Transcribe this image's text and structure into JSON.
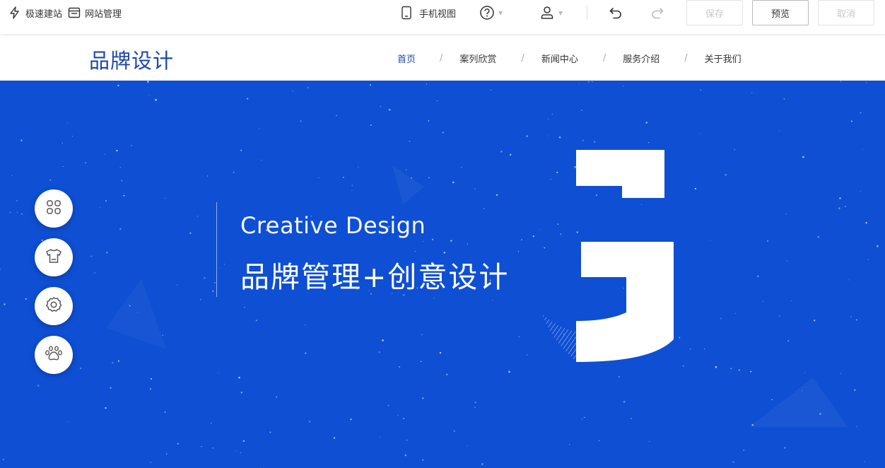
{
  "toolbar": {
    "quick_build_label": "极速建站",
    "site_manage_label": "网站管理",
    "mobile_view_label": "手机视图",
    "save_label": "保存",
    "preview_label": "预览",
    "cancel_label": "取消"
  },
  "site": {
    "logo_text": "品牌设计",
    "nav": [
      "首页",
      "案列欣赏",
      "新闻中心",
      "服务介绍",
      "关于我们"
    ],
    "nav_separator": "/",
    "accent_color": "#1e47a8"
  },
  "hero": {
    "subtitle": "Creative Design",
    "title": "品牌管理+创意设计",
    "background_color": "#0e4fd3",
    "graphic_letter": "G"
  },
  "side_buttons": [
    "apps-icon",
    "shirt-icon",
    "gear-icon",
    "paw-icon"
  ]
}
